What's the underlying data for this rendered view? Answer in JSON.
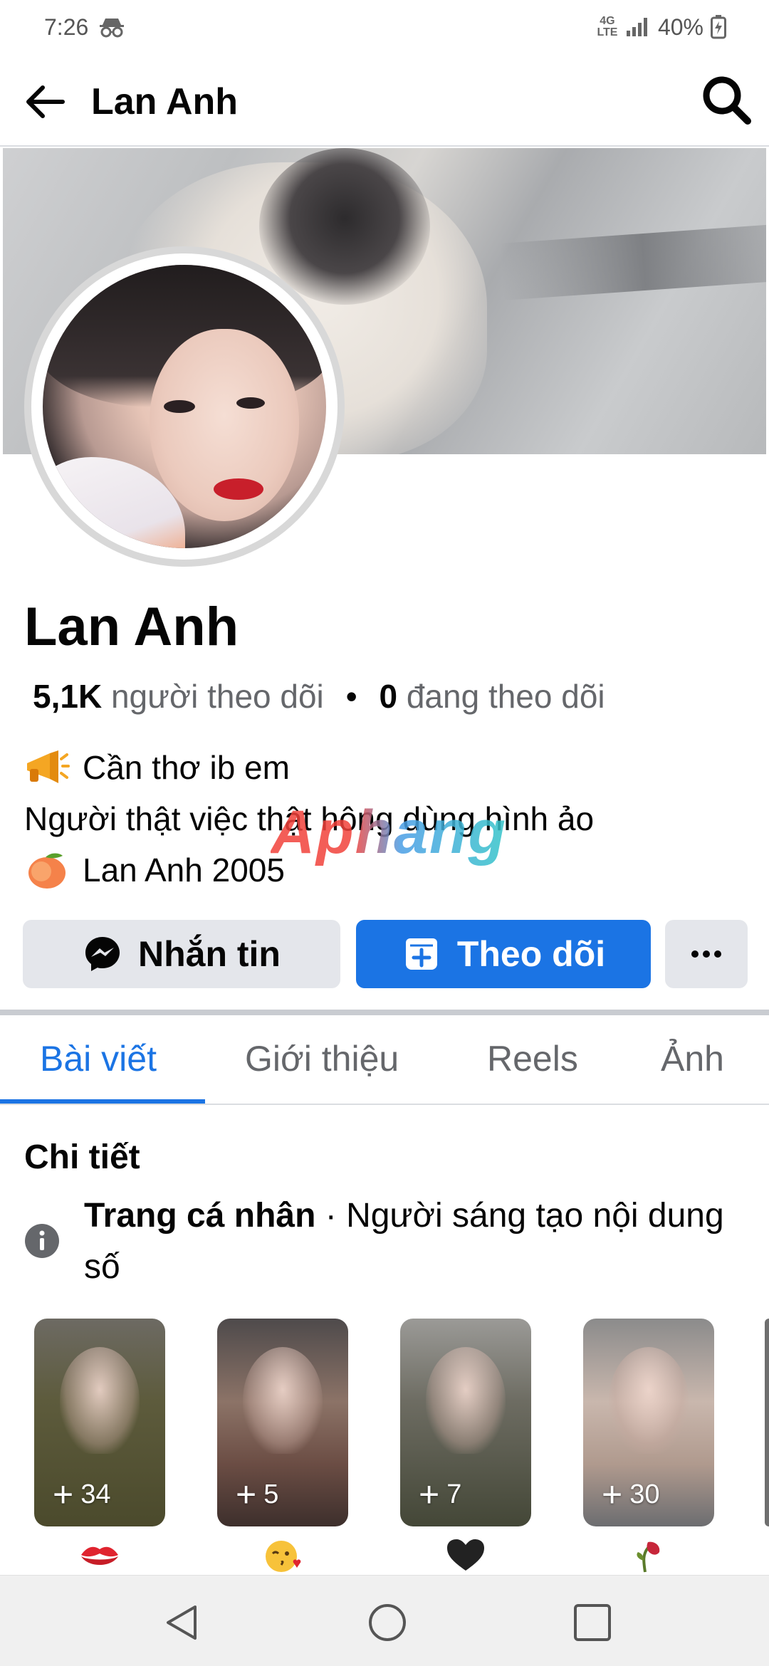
{
  "status_bar": {
    "time": "7:26",
    "network": "4G LTE",
    "battery": "40%"
  },
  "header": {
    "title": "Lan Anh"
  },
  "profile": {
    "name": "Lan Anh",
    "followers_count": "5,1K",
    "followers_label": "người theo dõi",
    "following_count": "0",
    "following_label": "đang theo dõi",
    "bio": [
      {
        "emoji": "megaphone",
        "text": "Cần thơ ib em"
      },
      {
        "emoji": "",
        "text": "Người thật việc thật hông dùng hình ảo"
      },
      {
        "emoji": "peach",
        "text": "Lan Anh 2005"
      }
    ]
  },
  "watermark": "Aphang",
  "actions": {
    "message_label": "Nhắn tin",
    "follow_label": "Theo dõi",
    "more_label": "···"
  },
  "tabs": [
    {
      "label": "Bài viết",
      "active": true
    },
    {
      "label": "Giới thiệu",
      "active": false
    },
    {
      "label": "Reels",
      "active": false
    },
    {
      "label": "Ảnh",
      "active": false
    }
  ],
  "details": {
    "title": "Chi tiết",
    "type_label": "Trang cá nhân",
    "type_value": " · Người sáng tạo nội dung số"
  },
  "highlights": [
    {
      "count": "34",
      "emoji": "kiss-mark"
    },
    {
      "count": "5",
      "emoji": "face-blowing-kiss"
    },
    {
      "count": "7",
      "emoji": "black-heart"
    },
    {
      "count": "30",
      "emoji": "wilted-rose"
    }
  ],
  "colors": {
    "accent": "#1b74e4",
    "button_gray": "#e4e6eb",
    "text_secondary": "#65676b"
  }
}
